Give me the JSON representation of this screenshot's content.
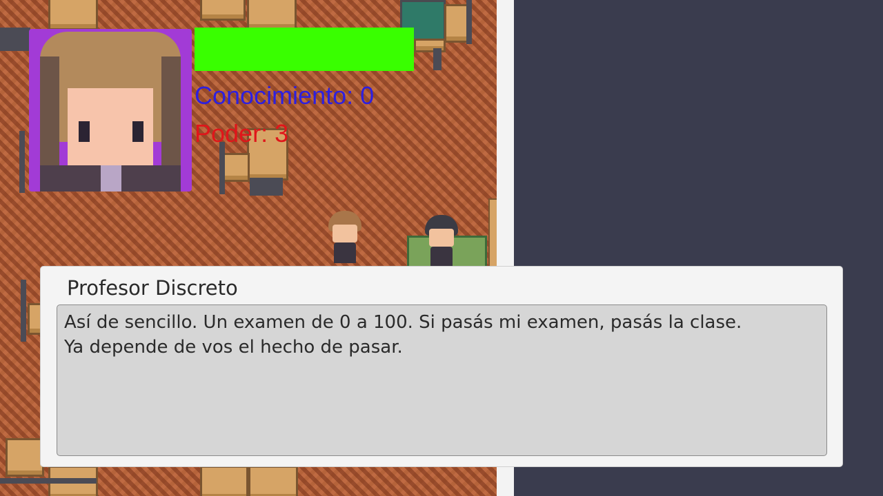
{
  "hud": {
    "health_fraction": 1.0,
    "health_color": "#39ff00",
    "knowledge_label": "Conocimiento: 0",
    "power_label": "Poder: 3",
    "knowledge_color": "#2d1fe0",
    "power_color": "#e0151a",
    "portrait_frame_color": "#a23bd6"
  },
  "dialog": {
    "speaker": "Profesor Discreto",
    "lines": [
      "Así de sencillo. Un examen de 0 a 100. Si pasás mi examen, pasás la clase.",
      "Ya depende de vos el hecho de pasar."
    ]
  },
  "scene": {
    "floor_color": "#b5633a",
    "panel_color": "#3a3c4e"
  }
}
